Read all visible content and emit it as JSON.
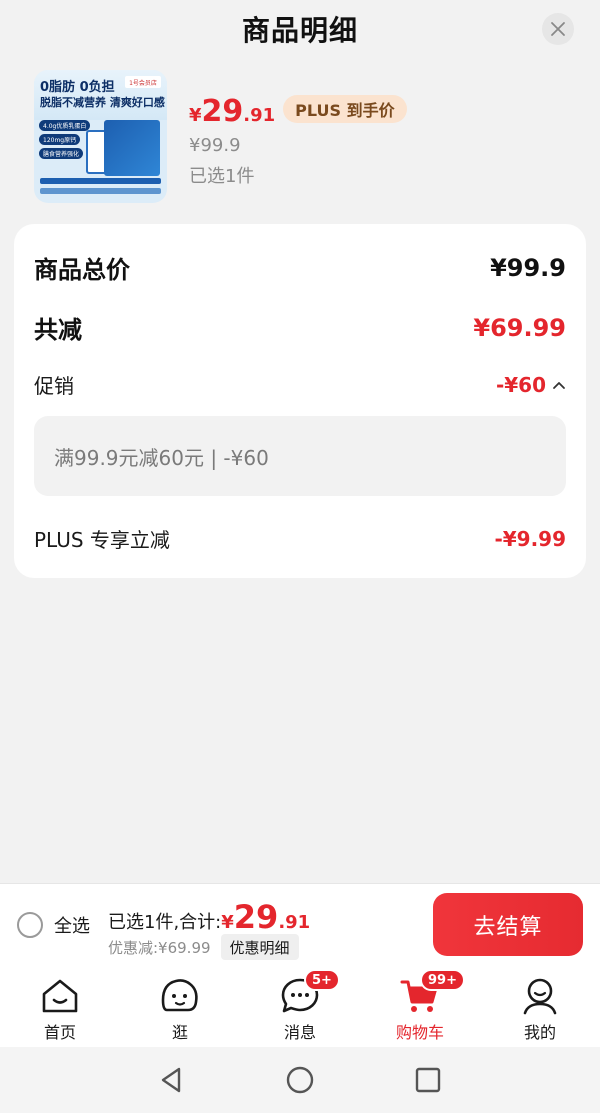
{
  "header": {
    "title": "商品明细"
  },
  "product": {
    "thumb_line1": "0脂肪 0负担",
    "thumb_line2": "脱脂不减营养 清爽好口感",
    "thumb_chip1": "4.0g优质乳蛋白",
    "thumb_chip2": "120mg原钙",
    "thumb_chip3": "膳食营养强化",
    "thumb_logo": "1号会员店",
    "price_symbol": "¥",
    "price_int": "29",
    "price_dec": ".91",
    "plus_tag": "PLUS 到手价",
    "original_price": "¥99.9",
    "selected_count": "已选1件"
  },
  "details": {
    "total_label": "商品总价",
    "total_value": "¥99.9",
    "reduce_label": "共减",
    "reduce_value": "¥69.99",
    "promo_label": "促销",
    "promo_value": "-¥60",
    "promo_detail": "满99.9元减60元 | -¥60",
    "plus_label": "PLUS 专享立减",
    "plus_value": "-¥9.99"
  },
  "checkout": {
    "select_all": "全选",
    "total_label": "已选1件,合计:",
    "price_symbol": "¥",
    "price_int": "29",
    "price_dec": ".91",
    "discount_text": "优惠减:¥69.99",
    "discount_detail_btn": "优惠明细",
    "checkout_btn": "去结算"
  },
  "tabs": [
    {
      "label": "首页",
      "icon": "home-icon"
    },
    {
      "label": "逛",
      "icon": "explore-icon"
    },
    {
      "label": "消息",
      "icon": "message-icon",
      "badge": "5+"
    },
    {
      "label": "购物车",
      "icon": "cart-icon",
      "badge": "99+",
      "active": true
    },
    {
      "label": "我的",
      "icon": "profile-icon"
    }
  ],
  "colors": {
    "accent": "#e4262d",
    "plus_tag_bg": "#fbe3cf"
  }
}
